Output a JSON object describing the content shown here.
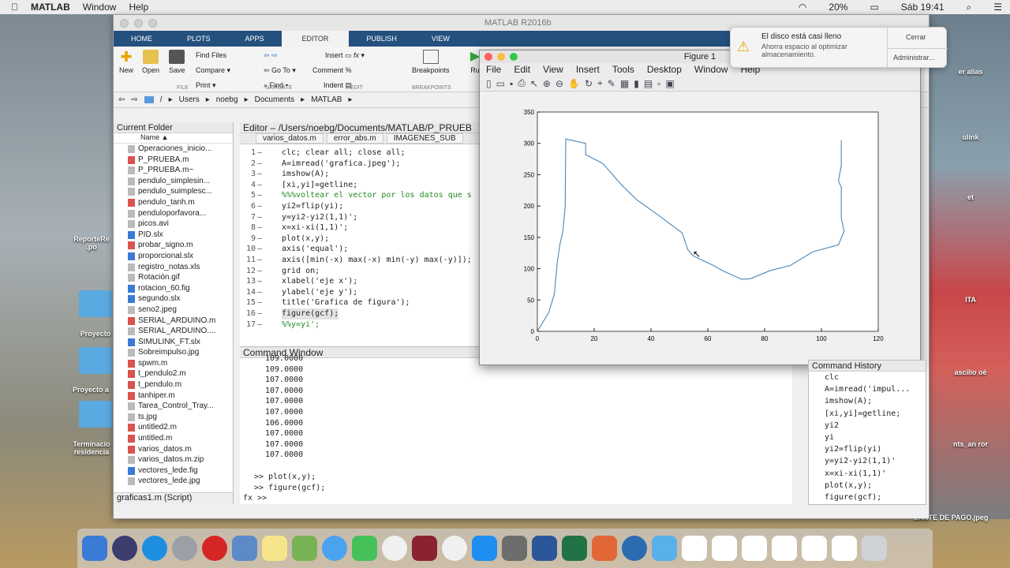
{
  "menubar": {
    "app": "MATLAB",
    "items": [
      "Window",
      "Help"
    ],
    "battery": "20%",
    "clock": "Sáb 19:41"
  },
  "window": {
    "title": "MATLAB R2016b"
  },
  "tabs": [
    "HOME",
    "PLOTS",
    "APPS",
    "EDITOR",
    "PUBLISH",
    "VIEW"
  ],
  "ribbon": {
    "new": "New",
    "open": "Open",
    "save": "Save",
    "find_files": "Find Files",
    "compare": "Compare",
    "print": "Print",
    "goto": "Go To",
    "find": "Find",
    "insert": "Insert",
    "comment": "Comment",
    "indent": "Indent",
    "breakpoints": "Breakpoints",
    "run": "Ru",
    "sections": [
      "FILE",
      "NAVIGATE",
      "EDIT",
      "BREAKPOINTS"
    ]
  },
  "address": [
    "/",
    "Users",
    "noebg",
    "Documents",
    "MATLAB"
  ],
  "current_folder": {
    "title": "Current Folder",
    "col": "Name ▲",
    "files": [
      "Operaciones_inicio...",
      "P_PRUEBA.m",
      "P_PRUEBA.m~",
      "pendulo_simplesin...",
      "pendulo_suimplesc...",
      "pendulo_tanh.m",
      "penduloporfavora...",
      "picos.avi",
      "PID.slx",
      "probar_signo.m",
      "proporcional.slx",
      "registro_notas.xls",
      "Rotación.gif",
      "rotacion_60.fig",
      "segundo.slx",
      "seno2.jpeg",
      "SERIAL_ARDUINO.m",
      "SERIAL_ARDUINO....",
      "SIMULINK_FT.slx",
      "Sobreimpulso.jpg",
      "spwm.m",
      "t_pendulo2.m",
      "t_pendulo.m",
      "tanhiper.m",
      "Tarea_Control_Tray...",
      "ts.jpg",
      "untitled2.m",
      "untitled.m",
      "varios_datos.m",
      "varios_datos.m.zip",
      "vectores_lede.fig",
      "vectores_lede.jpg"
    ],
    "footer": "graficas1.m  (Script)"
  },
  "editor": {
    "title": "Editor – /Users/noebg/Documents/MATLAB/P_PRUEB",
    "tabs": [
      "varios_datos.m",
      "error_abs.m",
      "IMAGENES_SUB"
    ],
    "lines": [
      "clc; clear all; close all;",
      "A=imread('grafica.jpeg');",
      "imshow(A);",
      "[xi,yi]=getline;",
      "%%%voltear el vector por los datos que s",
      "yi2=flip(yi);",
      "y=yi2-yi2(1,1)';",
      "x=xi-xi(1,1)';",
      "plot(x,y);",
      "axis('equal');",
      "axis([min(-x) max(-x) min(-y) max(-y)]);",
      "grid on;",
      "xlabel('eje x');",
      "ylabel('eje y');",
      "title('Grafica de figura');",
      "figure(gcf);",
      "%%y=yi';"
    ]
  },
  "command_window": {
    "title": "Command Window",
    "values": [
      "109.0000",
      "109.0000",
      "107.0000",
      "107.0000",
      "107.0000",
      "107.0000",
      "106.0000",
      "107.0000",
      "107.0000",
      "107.0000"
    ],
    "commands": [
      ">> plot(x,y);",
      ">> figure(gcf);"
    ],
    "prompt": "fx >>"
  },
  "figure": {
    "title": "Figure 1",
    "menu": [
      "File",
      "Edit",
      "View",
      "Insert",
      "Tools",
      "Desktop",
      "Window",
      "Help"
    ]
  },
  "chart_data": {
    "type": "line",
    "title": "",
    "xlabel": "",
    "ylabel": "",
    "xlim": [
      0,
      120
    ],
    "ylim": [
      0,
      350
    ],
    "xticks": [
      0,
      20,
      40,
      60,
      80,
      100,
      120
    ],
    "yticks": [
      0,
      50,
      100,
      150,
      200,
      250,
      300,
      350
    ],
    "color": "#4a86b8",
    "x": [
      0,
      4,
      6,
      7,
      8,
      9,
      9.8,
      10,
      17,
      17,
      23,
      30,
      35,
      43,
      51,
      53,
      55,
      62,
      66,
      72,
      75,
      82,
      89,
      97,
      106,
      108,
      107,
      107,
      106,
      107,
      107,
      107
    ],
    "y": [
      0,
      30,
      60,
      110,
      140,
      160,
      200,
      307,
      300,
      282,
      268,
      232,
      210,
      184,
      157,
      130,
      120,
      105,
      95,
      83,
      84,
      97,
      105,
      127,
      138,
      160,
      180,
      230,
      240,
      265,
      300,
      305
    ]
  },
  "notification": {
    "title": "El disco está casi lleno",
    "body": "Ahorra espacio al optimizar almacenamiento.",
    "close": "Cerrar",
    "manage": "Administrar..."
  },
  "history": {
    "title": "Command History",
    "items": [
      "clc",
      "A=imread('impul...",
      "imshow(A);",
      "[xi,yi]=getline;",
      "yi2",
      "yi",
      "yi2=flip(yi)",
      "y=yi2-yi2(1,1)'",
      "x=xi-xi(1,1)'",
      "plot(x,y);",
      "figure(gcf);"
    ]
  },
  "desktop": {
    "icons": [
      "ReporteRe .po",
      "Proyecto",
      "Proyecto a",
      "Terminacio residencia"
    ],
    "right_labels": [
      "er alias",
      "ulink",
      "et",
      "ITA",
      "ascilio oé",
      "nts_an ror",
      "SANTE DE PAGO.jpeg"
    ]
  }
}
